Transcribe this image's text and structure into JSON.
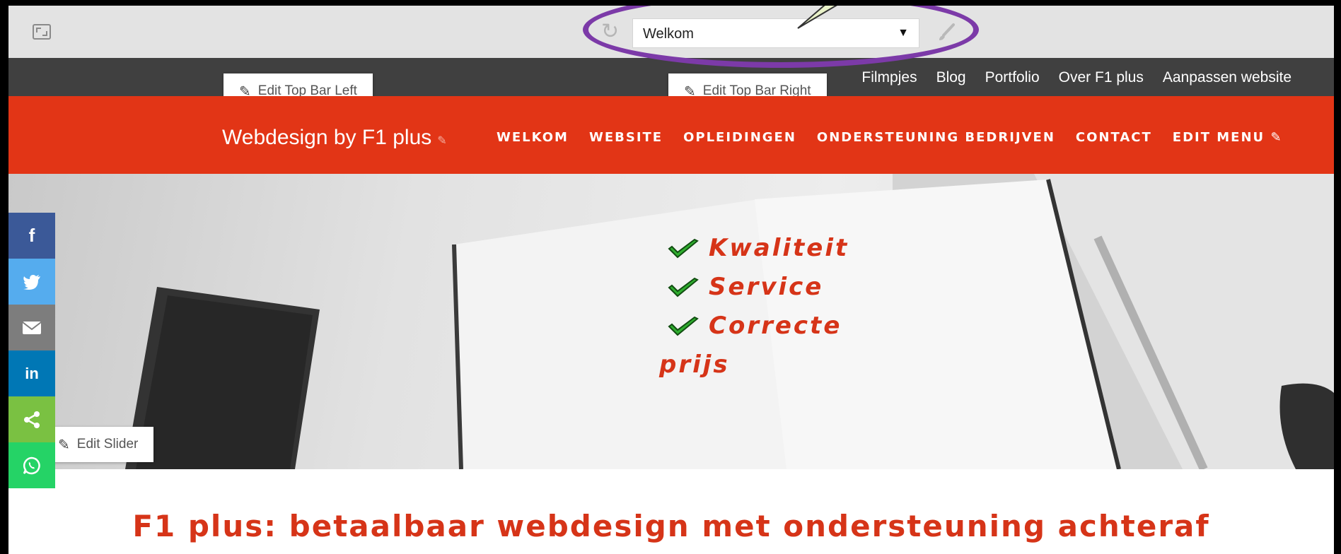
{
  "editor_toolbar": {
    "page_select_value": "Welkom",
    "icons": {
      "fullscreen": "fullscreen-icon",
      "refresh": "refresh-icon",
      "brush": "brush-icon",
      "dropdown": "triangle-down"
    }
  },
  "top_bar": {
    "edit_left_label": "Edit Top Bar Left",
    "edit_right_label": "Edit Top Bar Right",
    "links": [
      "Filmpjes",
      "Blog",
      "Portfolio",
      "Over F1 plus",
      "Aanpassen website"
    ]
  },
  "nav": {
    "site_title": "Webdesign by F1 plus",
    "menu": [
      "WELKOM",
      "WEBSITE",
      "OPLEIDINGEN",
      "ONDERSTEUNING BEDRIJVEN",
      "CONTACT",
      "EDIT MENU"
    ]
  },
  "hero": {
    "lines": [
      "Kwaliteit",
      "Service",
      "Correcte"
    ],
    "continuation": "prijs",
    "edit_slider_label": "Edit Slider"
  },
  "social_share": [
    {
      "icon": "facebook-icon",
      "label": "f",
      "color": "#3b5998"
    },
    {
      "icon": "twitter-icon",
      "label": "",
      "color": "#55acee"
    },
    {
      "icon": "email-icon",
      "label": "",
      "color": "#7d7d7d"
    },
    {
      "icon": "linkedin-icon",
      "label": "in",
      "color": "#0077b5"
    },
    {
      "icon": "share-icon",
      "label": "",
      "color": "#7ac142"
    },
    {
      "icon": "whatsapp-icon",
      "label": "",
      "color": "#25d366"
    }
  ],
  "main_heading": "F1 plus: betaalbaar webdesign met ondersteuning achteraf",
  "colors": {
    "accent_orange": "#e23516",
    "heading_red": "#d63418",
    "top_bar": "#404040",
    "highlight_purple": "#7c3aa8",
    "check_green": "#2fae2f"
  }
}
